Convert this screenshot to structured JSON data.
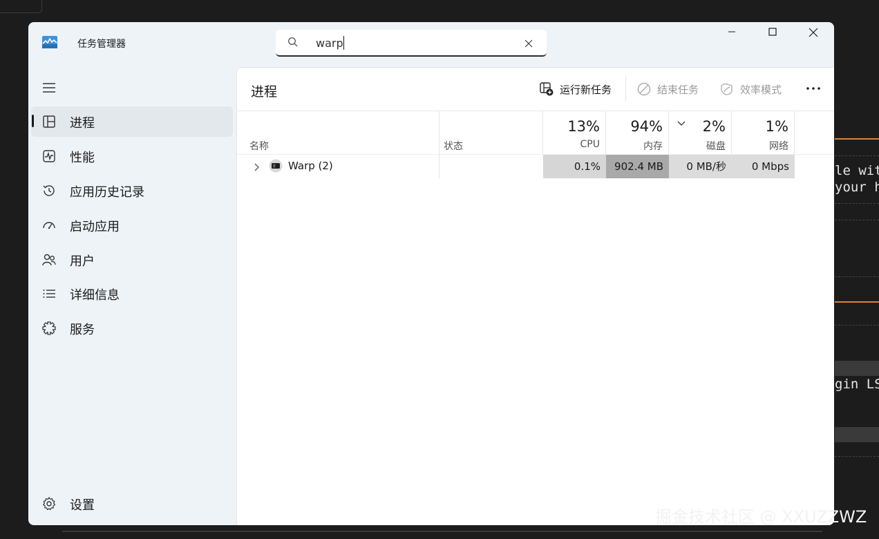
{
  "window": {
    "title": "任务管理器"
  },
  "search": {
    "value": "warp"
  },
  "sidebar": {
    "items": [
      {
        "label": "进程",
        "icon": "processes-icon",
        "active": true
      },
      {
        "label": "性能",
        "icon": "performance-icon"
      },
      {
        "label": "应用历史记录",
        "icon": "app-history-icon"
      },
      {
        "label": "启动应用",
        "icon": "startup-apps-icon"
      },
      {
        "label": "用户",
        "icon": "users-icon"
      },
      {
        "label": "详细信息",
        "icon": "details-icon"
      },
      {
        "label": "服务",
        "icon": "services-icon"
      }
    ],
    "settings_label": "设置"
  },
  "main": {
    "title": "进程",
    "toolbar": {
      "run_new_task": "运行新任务",
      "end_task": "结束任务",
      "efficiency_mode": "效率模式"
    },
    "columns": {
      "name": "名称",
      "status": "状态",
      "cpu": {
        "percent": "13%",
        "label": "CPU"
      },
      "memory": {
        "percent": "94%",
        "label": "内存"
      },
      "disk": {
        "percent": "2%",
        "label": "磁盘"
      },
      "network": {
        "percent": "1%",
        "label": "网络"
      }
    },
    "rows": [
      {
        "name": "Warp (2)",
        "status": "",
        "cpu": "0.1%",
        "memory": "902.4 MB",
        "disk": "0 MB/秒",
        "network": "0 Mbps"
      }
    ]
  },
  "background": {
    "terminal_lines": [
      "le wit",
      "your h",
      "gin LS"
    ],
    "watermark": "掘金技术社区 @ XXUZZWZ"
  },
  "colors": {
    "window_bg": "#eef3f7",
    "panel_bg": "#ffffff",
    "active_nav_bg": "#e3e8ec",
    "cpu_heat": "#d6d6d6",
    "memory_heat": "#a9a9a9",
    "disk_heat": "#dcdcdc",
    "network_heat": "#dcdcdc",
    "terminal_accent": "#d9833b"
  }
}
